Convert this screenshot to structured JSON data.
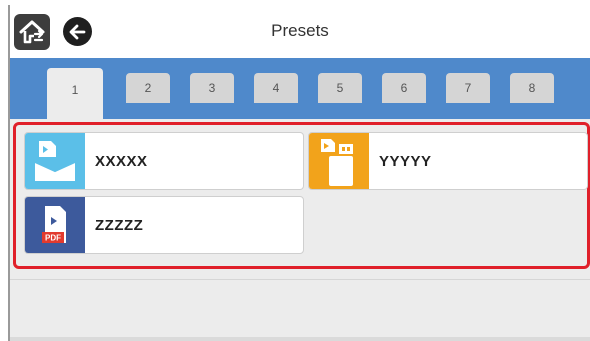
{
  "header": {
    "title": "Presets",
    "home_icon": "home-icon",
    "back_icon": "back-arrow-icon"
  },
  "tabs": [
    {
      "label": "1",
      "active": true
    },
    {
      "label": "2",
      "active": false
    },
    {
      "label": "3",
      "active": false
    },
    {
      "label": "4",
      "active": false
    },
    {
      "label": "5",
      "active": false
    },
    {
      "label": "6",
      "active": false
    },
    {
      "label": "7",
      "active": false
    },
    {
      "label": "8",
      "active": false
    }
  ],
  "presets": [
    {
      "label": "XXXXX",
      "icon": "scan-to-email-icon",
      "color": "#5bbfe8"
    },
    {
      "label": "YYYYY",
      "icon": "scan-to-memory-device-icon",
      "color": "#f2a31b"
    },
    {
      "label": "ZZZZZ",
      "icon": "pdf-document-icon",
      "color": "#3d5a9c"
    }
  ],
  "colors": {
    "tabbar": "#4f89cb",
    "highlight": "#e0202a"
  }
}
